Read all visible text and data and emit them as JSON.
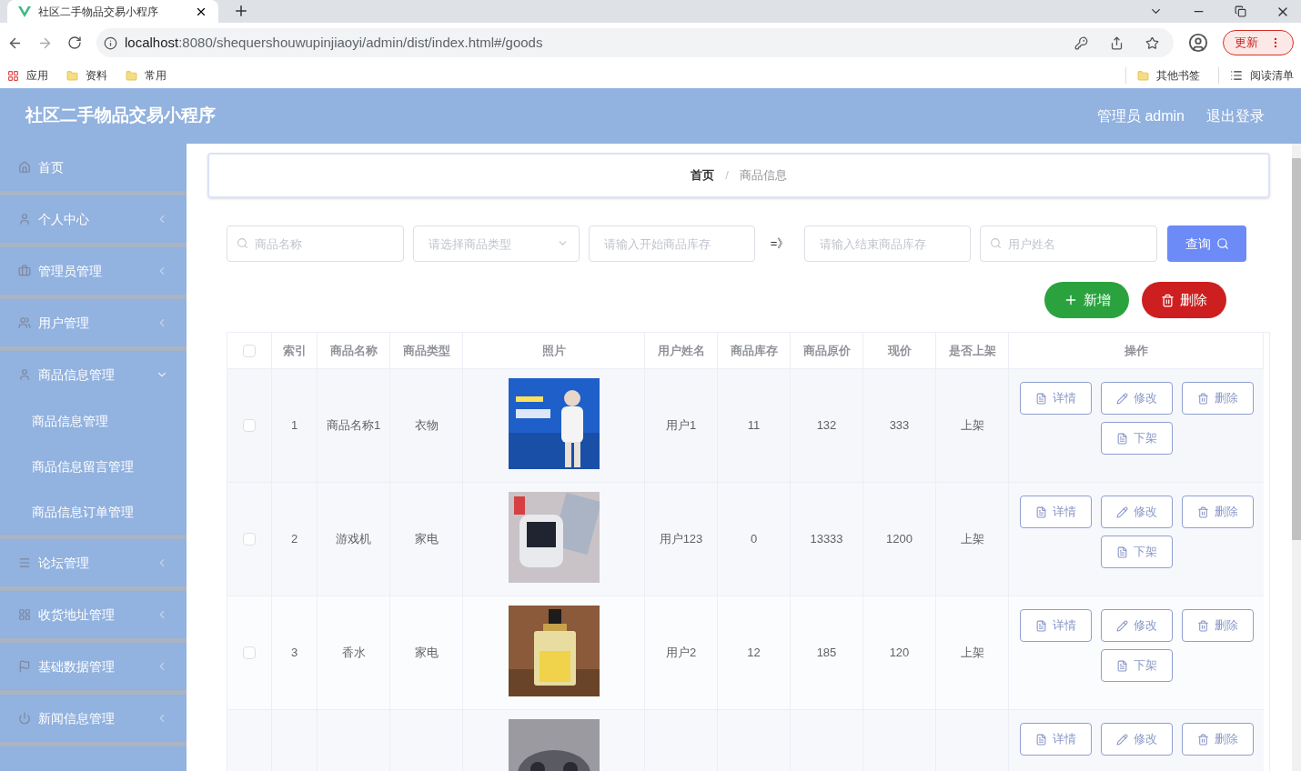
{
  "browser": {
    "tab_title": "社区二手物品交易小程序",
    "url_host": "localhost",
    "url_rest": ":8080/shequershouwupinjiaoyi/admin/dist/index.html#/goods",
    "update_label": "更新",
    "bookmarks": [
      {
        "label": "应用",
        "kind": "apps"
      },
      {
        "label": "资料",
        "kind": "folder"
      },
      {
        "label": "常用",
        "kind": "folder"
      }
    ],
    "bookmarks_right": [
      {
        "label": "其他书签",
        "kind": "folder"
      },
      {
        "label": "阅读清单",
        "kind": "list"
      }
    ]
  },
  "header": {
    "title": "社区二手物品交易小程序",
    "user": "管理员 admin",
    "logout": "退出登录"
  },
  "sidebar": {
    "items": [
      {
        "label": "首页"
      },
      {
        "label": "个人中心",
        "expanded": false
      },
      {
        "label": "管理员管理",
        "expanded": false
      },
      {
        "label": "用户管理",
        "expanded": false
      },
      {
        "label": "商品信息管理",
        "expanded": true,
        "children": [
          {
            "label": "商品信息管理"
          },
          {
            "label": "商品信息留言管理"
          },
          {
            "label": "商品信息订单管理"
          }
        ]
      },
      {
        "label": "论坛管理",
        "expanded": false
      },
      {
        "label": "收货地址管理",
        "expanded": false
      },
      {
        "label": "基础数据管理",
        "expanded": false
      },
      {
        "label": "新闻信息管理",
        "expanded": false
      }
    ]
  },
  "breadcrumb": [
    {
      "label": "首页",
      "selected": false
    },
    {
      "label": "商品信息",
      "selected": true
    }
  ],
  "breadcrumb_separator": "/",
  "filters": [
    {
      "kind": "search",
      "placeholder": "商品名称"
    },
    {
      "kind": "select",
      "placeholder": "请选择商品类型"
    },
    {
      "kind": "text",
      "placeholder": "请输入开始商品库存"
    },
    {
      "kind": "arrow",
      "text": "=》"
    },
    {
      "kind": "text",
      "placeholder": "请输入结束商品库存"
    },
    {
      "kind": "search",
      "placeholder": "用户姓名"
    }
  ],
  "query_button": "查询",
  "add_button": "新增",
  "delete_button": "删除",
  "table": {
    "select_all_checked": false,
    "columns": [
      "索引",
      "商品名称",
      "商品类型",
      "照片",
      "用户姓名",
      "商品库存",
      "商品原价",
      "现价",
      "是否上架",
      "操作"
    ],
    "rows": [
      {
        "checked": false,
        "cells": [
          "1",
          "商品名称1",
          "衣物",
          "用户1",
          "11",
          "132",
          "333",
          "上架"
        ],
        "actions": [
          "详情",
          "修改",
          "删除",
          "下架"
        ]
      },
      {
        "checked": false,
        "cells": [
          "2",
          "游戏机",
          "家电",
          "用户123",
          "0",
          "13333",
          "1200",
          "上架"
        ],
        "actions": [
          "详情",
          "修改",
          "删除",
          "下架"
        ]
      },
      {
        "checked": false,
        "cells": [
          "3",
          "香水",
          "家电",
          "用户2",
          "12",
          "185",
          "120",
          "上架"
        ],
        "actions": [
          "详情",
          "修改",
          "删除",
          "下架"
        ]
      },
      {
        "actions": [
          "详情",
          "修改",
          "删除"
        ]
      }
    ]
  }
}
